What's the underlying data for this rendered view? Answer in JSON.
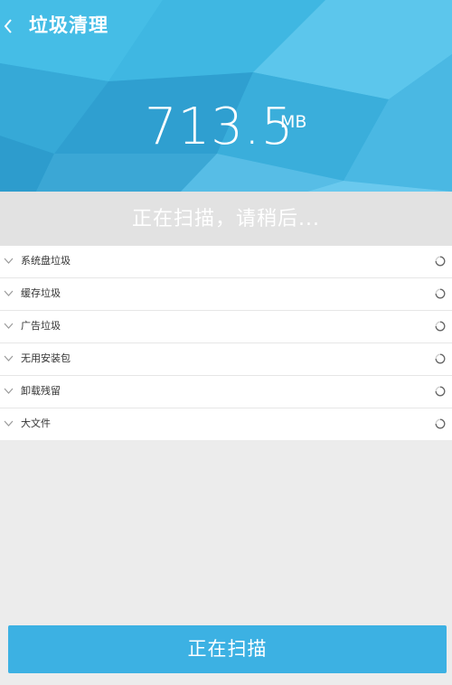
{
  "header": {
    "back_icon": "chevron-left-icon",
    "title": "垃圾清理"
  },
  "summary": {
    "size_value": "713.5",
    "size_unit": "MB"
  },
  "status": {
    "text": "正在扫描，请稍后..."
  },
  "categories": [
    {
      "label": "系统盘垃圾",
      "icon": "chevron-down-icon",
      "state_icon": "loading-spinner-icon"
    },
    {
      "label": "缓存垃圾",
      "icon": "chevron-down-icon",
      "state_icon": "loading-spinner-icon"
    },
    {
      "label": "广告垃圾",
      "icon": "chevron-down-icon",
      "state_icon": "loading-spinner-icon"
    },
    {
      "label": "无用安装包",
      "icon": "chevron-down-icon",
      "state_icon": "loading-spinner-icon"
    },
    {
      "label": "卸载残留",
      "icon": "chevron-down-icon",
      "state_icon": "loading-spinner-icon"
    },
    {
      "label": "大文件",
      "icon": "chevron-down-icon",
      "state_icon": "loading-spinner-icon"
    }
  ],
  "action": {
    "button_label": "正在扫描"
  },
  "colors": {
    "header_blue": "#3bb2df",
    "button_blue": "#3cb1e3",
    "page_background": "#ececec"
  }
}
